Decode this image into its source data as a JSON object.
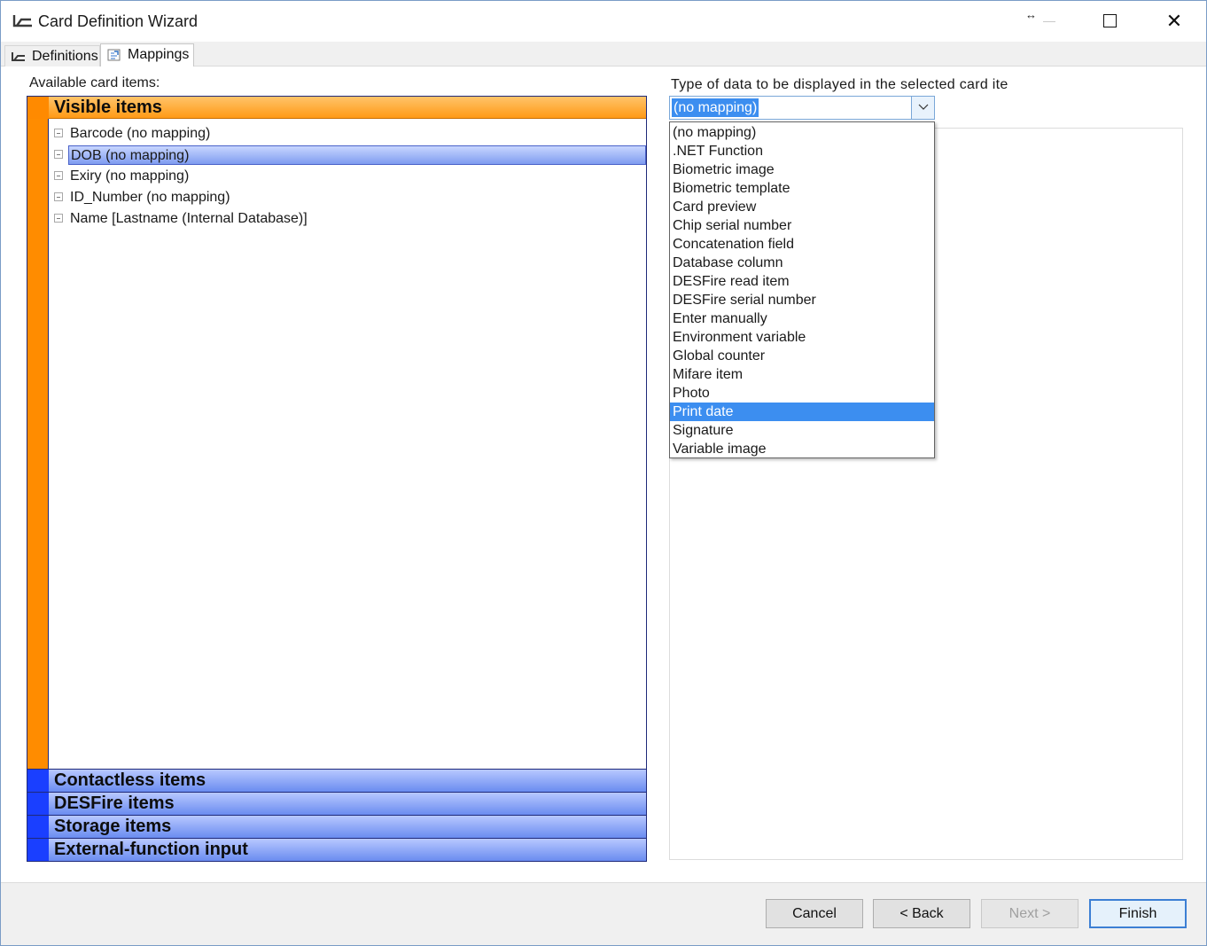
{
  "window": {
    "title": "Card Definition Wizard",
    "resize_hint": "↔",
    "close_glyph": "✕"
  },
  "tabs": [
    {
      "label": "Definitions",
      "icon": "card-wizard-icon",
      "active": false
    },
    {
      "label": "Mappings",
      "icon": "mappings-icon",
      "active": true
    }
  ],
  "items_panel": {
    "label": "Available card items:",
    "visible_header": "Visible items",
    "items": [
      {
        "label": "Barcode (no mapping)",
        "selected": false
      },
      {
        "label": "DOB (no mapping)",
        "selected": true
      },
      {
        "label": "Exiry (no mapping)",
        "selected": false
      },
      {
        "label": "ID_Number (no mapping)",
        "selected": false
      },
      {
        "label": "Name [Lastname (Internal Database)]",
        "selected": false
      }
    ],
    "groups": [
      {
        "label": "Contactless items"
      },
      {
        "label": "DESFire items"
      },
      {
        "label": "Storage items"
      },
      {
        "label": "External-function input"
      }
    ]
  },
  "type_selector": {
    "label": "Type of data to be displayed in the selected card ite",
    "value": "(no mapping)",
    "options": [
      "(no mapping)",
      ".NET Function",
      "Biometric image",
      "Biometric template",
      "Card preview",
      "Chip serial number",
      "Concatenation field",
      "Database column",
      "DESFire read item",
      "DESFire serial number",
      "Enter manually",
      "Environment variable",
      "Global counter",
      "Mifare item",
      "Photo",
      "Print date",
      "Signature",
      "Variable image"
    ],
    "highlighted_index": 15
  },
  "buttons": {
    "cancel": "Cancel",
    "back": "< Back",
    "next": "Next >",
    "finish": "Finish"
  },
  "colors": {
    "visible_accent": "#ff8c00",
    "group_accent": "#1a3fff",
    "selection": "#3c8ef0"
  }
}
